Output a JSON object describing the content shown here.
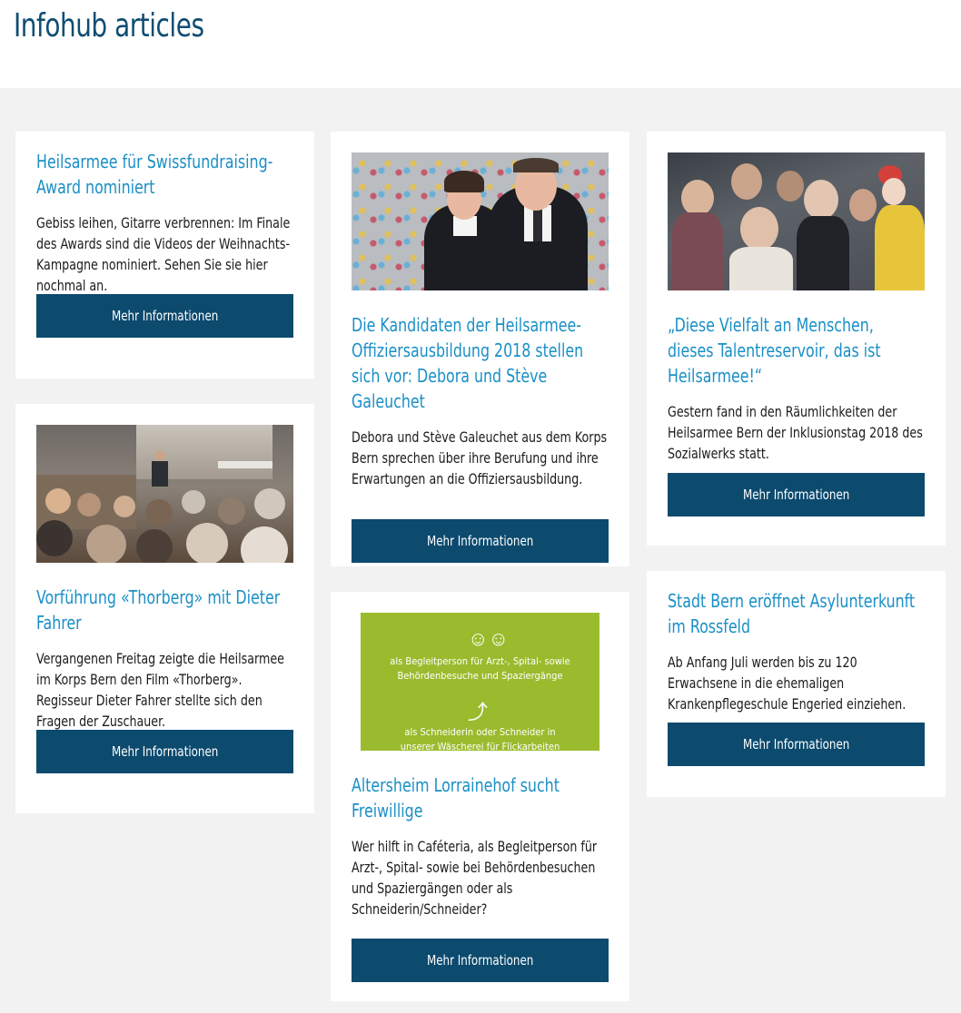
{
  "header": {
    "title": "Infohub articles"
  },
  "articles": [
    {
      "title": "Heilsarmee für Swissfundraising-Award nominiert",
      "text": "Gebiss leihen, Gitarre verbrennen: Im Finale des Awards sind die Videos der Weihnachts-Kampagne nominiert. Sehen Sie sie hier nochmal an.",
      "button": "Mehr Informationen"
    },
    {
      "title": "Vorführung «Thorberg» mit Dieter Fahrer",
      "text": "Vergangenen Freitag zeigte die Heilsarmee im Korps Bern den Film «Thorberg». Regisseur Dieter Fahrer stellte sich den Fragen der Zuschauer.",
      "button": "Mehr Informationen"
    },
    {
      "title": "Die Kandidaten der Heilsarmee-Offiziersausbildung 2018 stellen sich vor: Debora und Stève Galeuchet",
      "text": "Debora und Stève Galeuchet aus dem Korps Bern sprechen über ihre Berufung und ihre Erwartungen an die Offiziersausbildung.",
      "button": "Mehr Informationen"
    },
    {
      "title": "Altersheim Lorrainehof sucht Freiwillige",
      "text": "Wer hilft in Caféteria, als Begleitperson für Arzt-, Spital- sowie bei Behördenbesuchen und Spaziergängen oder als Schneiderin/Schneider?",
      "button": "Mehr Informationen",
      "image_text": [
        "als Begleitperson für Arzt-, Spital- sowie",
        "Behördenbesuche und Spaziergänge",
        "als Schneiderin oder Schneider in",
        "unserer Wäscherei für Flickarbeiten"
      ]
    },
    {
      "title": "„Diese Vielfalt an Menschen, dieses Talentreservoir, das ist Heilsarmee!“",
      "text": "Gestern fand in den Räumlichkeiten der Heilsarmee Bern der Inklusionstag 2018 des Sozialwerks statt.",
      "button": "Mehr Informationen"
    },
    {
      "title": "Stadt Bern eröffnet Asylunterkunft im Rossfeld",
      "text": "Ab Anfang Juli werden bis zu 120 Erwachsene in die ehemaligen Krankenpflegeschule Engeried einziehen.",
      "button": "Mehr Informationen"
    }
  ],
  "colors": {
    "title": "#0e4d72",
    "link": "#1a8fc6",
    "button": "#0c4a6e",
    "background": "#f2f2f2",
    "poster_green": "#9bbb2e"
  }
}
